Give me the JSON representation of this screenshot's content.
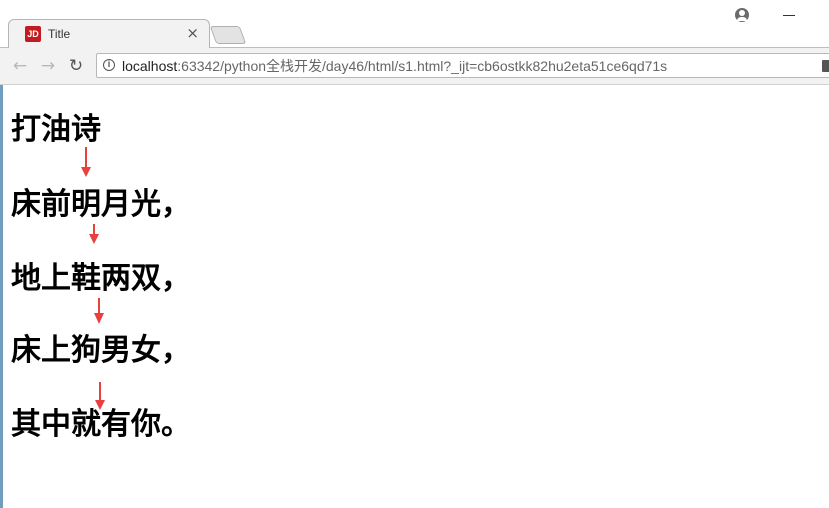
{
  "browser": {
    "tab": {
      "favicon_text": "JD",
      "title": "Title",
      "close_glyph": "×"
    },
    "url_host": "localhost",
    "url_rest": ":63342/python全栈开发/day46/html/s1.html?_ijt=cb6ostkk82hu2eta51ce6qd71s",
    "nav": {
      "back": "←",
      "forward": "→",
      "reload": "↻"
    },
    "icons": [
      "profile-icon",
      "minimize-icon",
      "info-icon",
      "extension-icon"
    ]
  },
  "poem": {
    "title": "打油诗",
    "lines": [
      "床前明月光，",
      "地上鞋两双，",
      "床上狗男女，",
      "其中就有你。"
    ]
  },
  "colors": {
    "arrow": "#e8413d",
    "favicon": "#c41b20"
  }
}
